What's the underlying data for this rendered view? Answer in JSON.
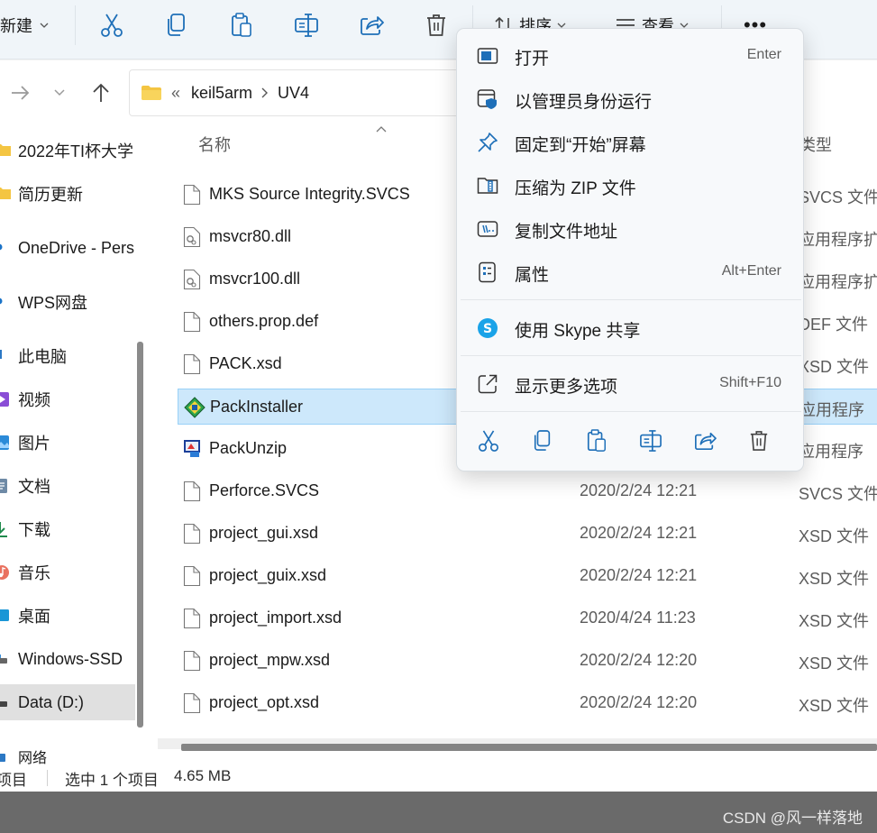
{
  "toolbar": {
    "new_label": "新建",
    "sort_label": "排序",
    "view_label": "查看",
    "more_label": "•••"
  },
  "address": {
    "overflow": "«",
    "crumbs": [
      "keil5arm",
      "UV4"
    ]
  },
  "sidebar": {
    "items": [
      {
        "label": "2022年TI杯大学",
        "icon": "folder-icon"
      },
      {
        "label": "简历更新",
        "icon": "folder-icon"
      },
      {
        "label": "OneDrive - Pers",
        "icon": "cloud-icon"
      },
      {
        "label": "WPS网盘",
        "icon": "cloud-icon"
      },
      {
        "label": "此电脑",
        "icon": "computer-icon"
      },
      {
        "label": "视频",
        "icon": "video-icon"
      },
      {
        "label": "图片",
        "icon": "picture-icon"
      },
      {
        "label": "文档",
        "icon": "document-icon"
      },
      {
        "label": "下载",
        "icon": "download-icon"
      },
      {
        "label": "音乐",
        "icon": "music-icon"
      },
      {
        "label": "桌面",
        "icon": "desktop-icon"
      },
      {
        "label": "Windows-SSD",
        "icon": "drive-icon"
      },
      {
        "label": "Data (D:)",
        "icon": "drive-icon"
      },
      {
        "label": "网络",
        "icon": "network-icon"
      }
    ]
  },
  "list": {
    "headers": {
      "name": "名称",
      "type": "类型"
    },
    "rows": [
      {
        "name": "MKS Source Integrity.SVCS",
        "date": "",
        "type": "SVCS 文件"
      },
      {
        "name": "msvcr80.dll",
        "date": "",
        "type": "应用程序扩"
      },
      {
        "name": "msvcr100.dll",
        "date": "",
        "type": "应用程序扩"
      },
      {
        "name": "others.prop.def",
        "date": "",
        "type": "DEF 文件"
      },
      {
        "name": "PACK.xsd",
        "date": "",
        "type": "XSD 文件"
      },
      {
        "name": "PackInstaller",
        "date": "",
        "type": "应用程序"
      },
      {
        "name": "PackUnzip",
        "date": "",
        "type": "应用程序"
      },
      {
        "name": "Perforce.SVCS",
        "date": "2020/2/24 12:21",
        "type": "SVCS 文件"
      },
      {
        "name": "project_gui.xsd",
        "date": "2020/2/24 12:21",
        "type": "XSD 文件"
      },
      {
        "name": "project_guix.xsd",
        "date": "2020/2/24 12:21",
        "type": "XSD 文件"
      },
      {
        "name": "project_import.xsd",
        "date": "2020/4/24 11:23",
        "type": "XSD 文件"
      },
      {
        "name": "project_mpw.xsd",
        "date": "2020/2/24 12:20",
        "type": "XSD 文件"
      },
      {
        "name": "project_opt.xsd",
        "date": "2020/2/24 12:20",
        "type": "XSD 文件"
      }
    ]
  },
  "status": {
    "items": "项目",
    "selected": "选中 1 个项目",
    "size": "4.65 MB"
  },
  "context_menu": {
    "open": {
      "label": "打开",
      "key": "Enter"
    },
    "run_as_admin": {
      "label": "以管理员身份运行"
    },
    "pin_start": {
      "label": "固定到“开始”屏幕"
    },
    "compress_zip": {
      "label": "压缩为 ZIP 文件"
    },
    "copy_path": {
      "label": "复制文件地址"
    },
    "properties": {
      "label": "属性",
      "key": "Alt+Enter"
    },
    "skype_share": {
      "label": "使用 Skype 共享"
    },
    "more_options": {
      "label": "显示更多选项",
      "key": "Shift+F10"
    }
  },
  "watermark": "CSDN @风一样落地",
  "colors": {
    "accent": "#0067c0",
    "selected_row": "#cde8fb",
    "folder": "#f4c542",
    "skype": "#1aa3e8"
  }
}
